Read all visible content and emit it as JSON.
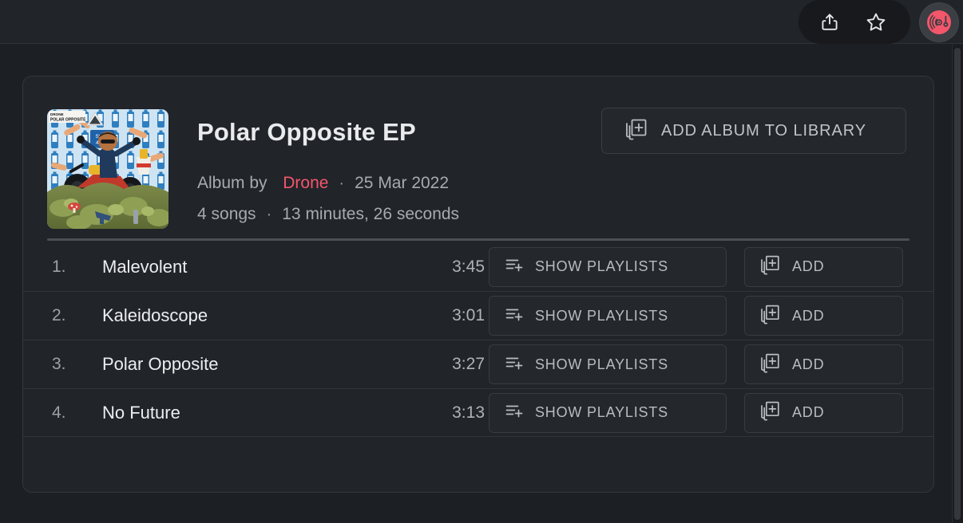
{
  "topbar": {
    "share_icon": "share-icon",
    "favorite_icon": "star-icon",
    "avatar_icon": "vinyl-record-icon"
  },
  "album": {
    "title": "Polar Opposite EP",
    "by_label": "Album by",
    "artist": "Drone",
    "release_date": "25 Mar 2022",
    "song_count": "4 songs",
    "duration": "13 minutes, 26 seconds",
    "separator": "·",
    "art_label_line1": "DRONE",
    "art_label_line2": "POLAR OPPOSITE",
    "art_sign_text": "Steep 400m",
    "accent_color": "#f4566b",
    "add_album_button": {
      "label": "ADD ALBUM TO LIBRARY",
      "icon": "add-to-library-icon"
    }
  },
  "tracks": [
    {
      "num": "1.",
      "name": "Malevolent",
      "duration": "3:45",
      "playlists_label": "SHOW PLAYLISTS",
      "add_label": "ADD"
    },
    {
      "num": "2.",
      "name": "Kaleidoscope",
      "duration": "3:01",
      "playlists_label": "SHOW PLAYLISTS",
      "add_label": "ADD"
    },
    {
      "num": "3.",
      "name": "Polar Opposite",
      "duration": "3:27",
      "playlists_label": "SHOW PLAYLISTS",
      "add_label": "ADD"
    },
    {
      "num": "4.",
      "name": "No Future",
      "duration": "3:13",
      "playlists_label": "SHOW PLAYLISTS",
      "add_label": "ADD"
    }
  ]
}
